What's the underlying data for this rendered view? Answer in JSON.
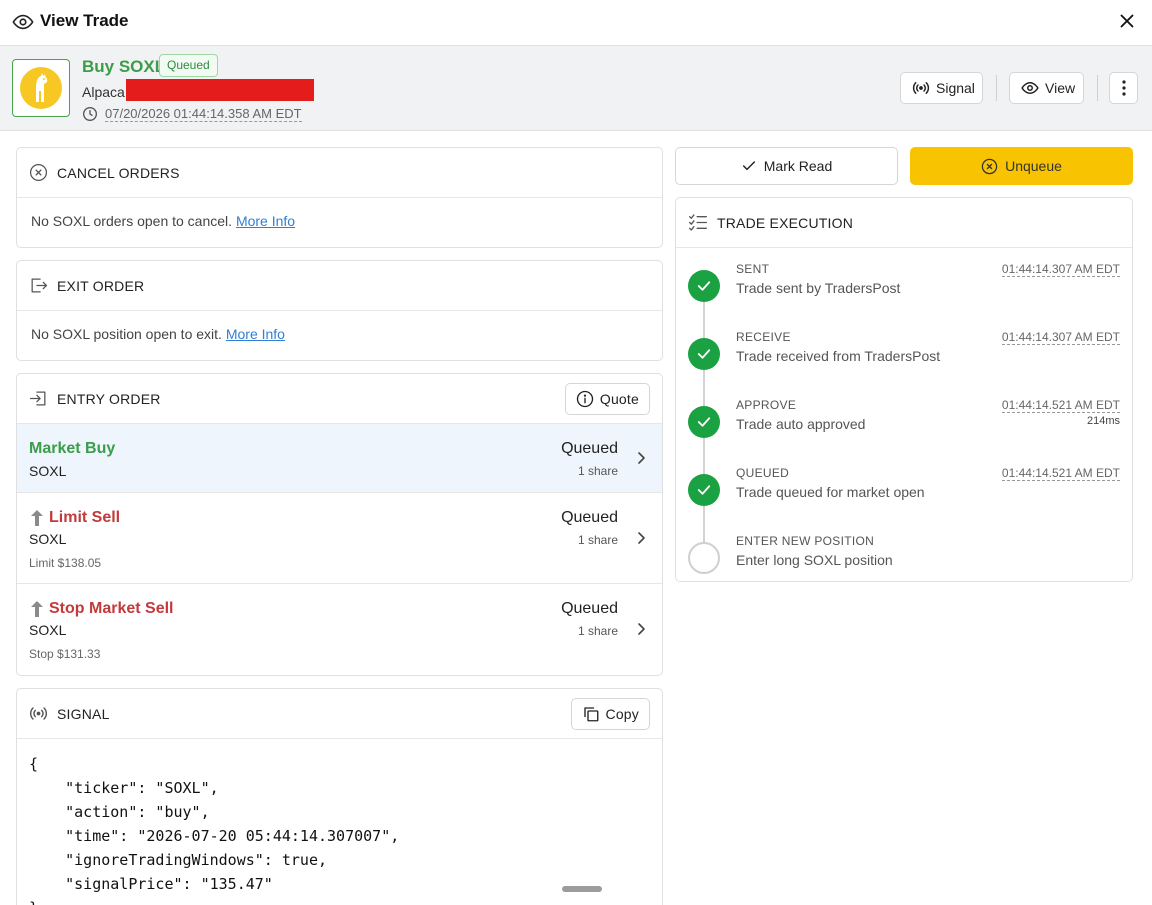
{
  "window": {
    "title": "View Trade"
  },
  "header": {
    "trade_title": "Buy SOXL",
    "status_badge": "Queued",
    "broker": "Alpaca",
    "timestamp": "07/20/2026 01:44:14.358 AM EDT",
    "signal_label": "Signal",
    "view_label": "View"
  },
  "cancel_orders": {
    "title": "CANCEL ORDERS",
    "message": "No SOXL orders open to cancel.",
    "link": "More Info"
  },
  "exit_order": {
    "title": "EXIT ORDER",
    "message": "No SOXL position open to exit.",
    "link": "More Info"
  },
  "entry_order": {
    "title": "ENTRY ORDER",
    "quote_label": "Quote",
    "orders": [
      {
        "name": "Market Buy",
        "symbol": "SOXL",
        "price": "",
        "status": "Queued",
        "qty": "1 share"
      },
      {
        "name": "Limit Sell",
        "symbol": "SOXL",
        "price": "Limit $138.05",
        "status": "Queued",
        "qty": "1 share"
      },
      {
        "name": "Stop Market Sell",
        "symbol": "SOXL",
        "price": "Stop $131.33",
        "status": "Queued",
        "qty": "1 share"
      }
    ]
  },
  "signal": {
    "title": "SIGNAL",
    "copy_label": "Copy",
    "json_text": "{\n    \"ticker\": \"SOXL\",\n    \"action\": \"buy\",\n    \"time\": \"2026-07-20 05:44:14.307007\",\n    \"ignoreTradingWindows\": true,\n    \"signalPrice\": \"135.47\"\n}"
  },
  "actions": {
    "mark_read": "Mark Read",
    "unqueue": "Unqueue"
  },
  "trade_execution": {
    "title": "TRADE EXECUTION",
    "steps": [
      {
        "label": "SENT",
        "desc": "Trade sent by TradersPost",
        "time": "01:44:14.307 AM EDT",
        "duration": "",
        "done": true
      },
      {
        "label": "RECEIVE",
        "desc": "Trade received from TradersPost",
        "time": "01:44:14.307 AM EDT",
        "duration": "",
        "done": true
      },
      {
        "label": "APPROVE",
        "desc": "Trade auto approved",
        "time": "01:44:14.521 AM EDT",
        "duration": "214ms",
        "done": true
      },
      {
        "label": "QUEUED",
        "desc": "Trade queued for market open",
        "time": "01:44:14.521 AM EDT",
        "duration": "",
        "done": true
      },
      {
        "label": "ENTER NEW POSITION",
        "desc": "Enter long SOXL position",
        "time": "",
        "duration": "",
        "done": false
      }
    ]
  },
  "colors": {
    "green": "#3b9c4a",
    "red": "#c23a3a",
    "yellow": "#f8c301",
    "check": "#1aa142",
    "link": "#2f7fd6"
  },
  "icons": [
    "eye-icon",
    "close-icon",
    "clock-icon",
    "signal-icon",
    "more-vertical-icon",
    "x-circle-icon",
    "exit-icon",
    "entry-icon",
    "info-icon",
    "chevron-right-icon",
    "arrow-up-icon",
    "copy-icon",
    "check-icon",
    "checklist-icon"
  ]
}
